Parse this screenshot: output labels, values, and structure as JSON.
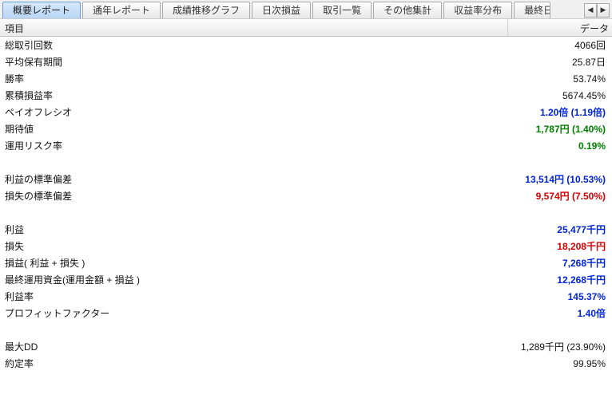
{
  "tabs": [
    "概要レポート",
    "通年レポート",
    "成績推移グラフ",
    "日次損益",
    "取引一覧",
    "その他集計",
    "収益率分布",
    "最終日："
  ],
  "active_tab_index": 0,
  "nav": {
    "left": "◀",
    "right": "▶"
  },
  "columns": {
    "item": "項目",
    "data": "データ"
  },
  "rows": [
    {
      "label": "総取引回数",
      "value": "4066回",
      "color": "black"
    },
    {
      "label": "平均保有期間",
      "value": "25.87日",
      "color": "black"
    },
    {
      "label": "勝率",
      "value": "53.74%",
      "color": "black"
    },
    {
      "label": "累積損益率",
      "value": "5674.45%",
      "color": "black"
    },
    {
      "label": "ペイオフレシオ",
      "value": "1.20倍 (1.19倍)",
      "color": "blue"
    },
    {
      "label": "期待値",
      "value": "1,787円 (1.40%)",
      "color": "green"
    },
    {
      "label": "運用リスク率",
      "value": "0.19%",
      "color": "green"
    },
    {
      "blank": true
    },
    {
      "label": "利益の標準偏差",
      "value": "13,514円 (10.53%)",
      "color": "blue"
    },
    {
      "label": "損失の標準偏差",
      "value": "9,574円 (7.50%)",
      "color": "red"
    },
    {
      "blank": true
    },
    {
      "label": "利益",
      "value": "25,477千円",
      "color": "blue"
    },
    {
      "label": "損失",
      "value": "18,208千円",
      "color": "red"
    },
    {
      "label": "損益( 利益 + 損失 )",
      "value": "7,268千円",
      "color": "blue"
    },
    {
      "label": "最終運用資金(運用金額 + 損益 )",
      "value": "12,268千円",
      "color": "blue"
    },
    {
      "label": "利益率",
      "value": "145.37%",
      "color": "blue"
    },
    {
      "label": "プロフィットファクター",
      "value": "1.40倍",
      "color": "blue"
    },
    {
      "blank": true
    },
    {
      "label": "最大DD",
      "value": "1,289千円 (23.90%)",
      "color": "black"
    },
    {
      "label": "約定率",
      "value": "99.95%",
      "color": "black"
    }
  ]
}
